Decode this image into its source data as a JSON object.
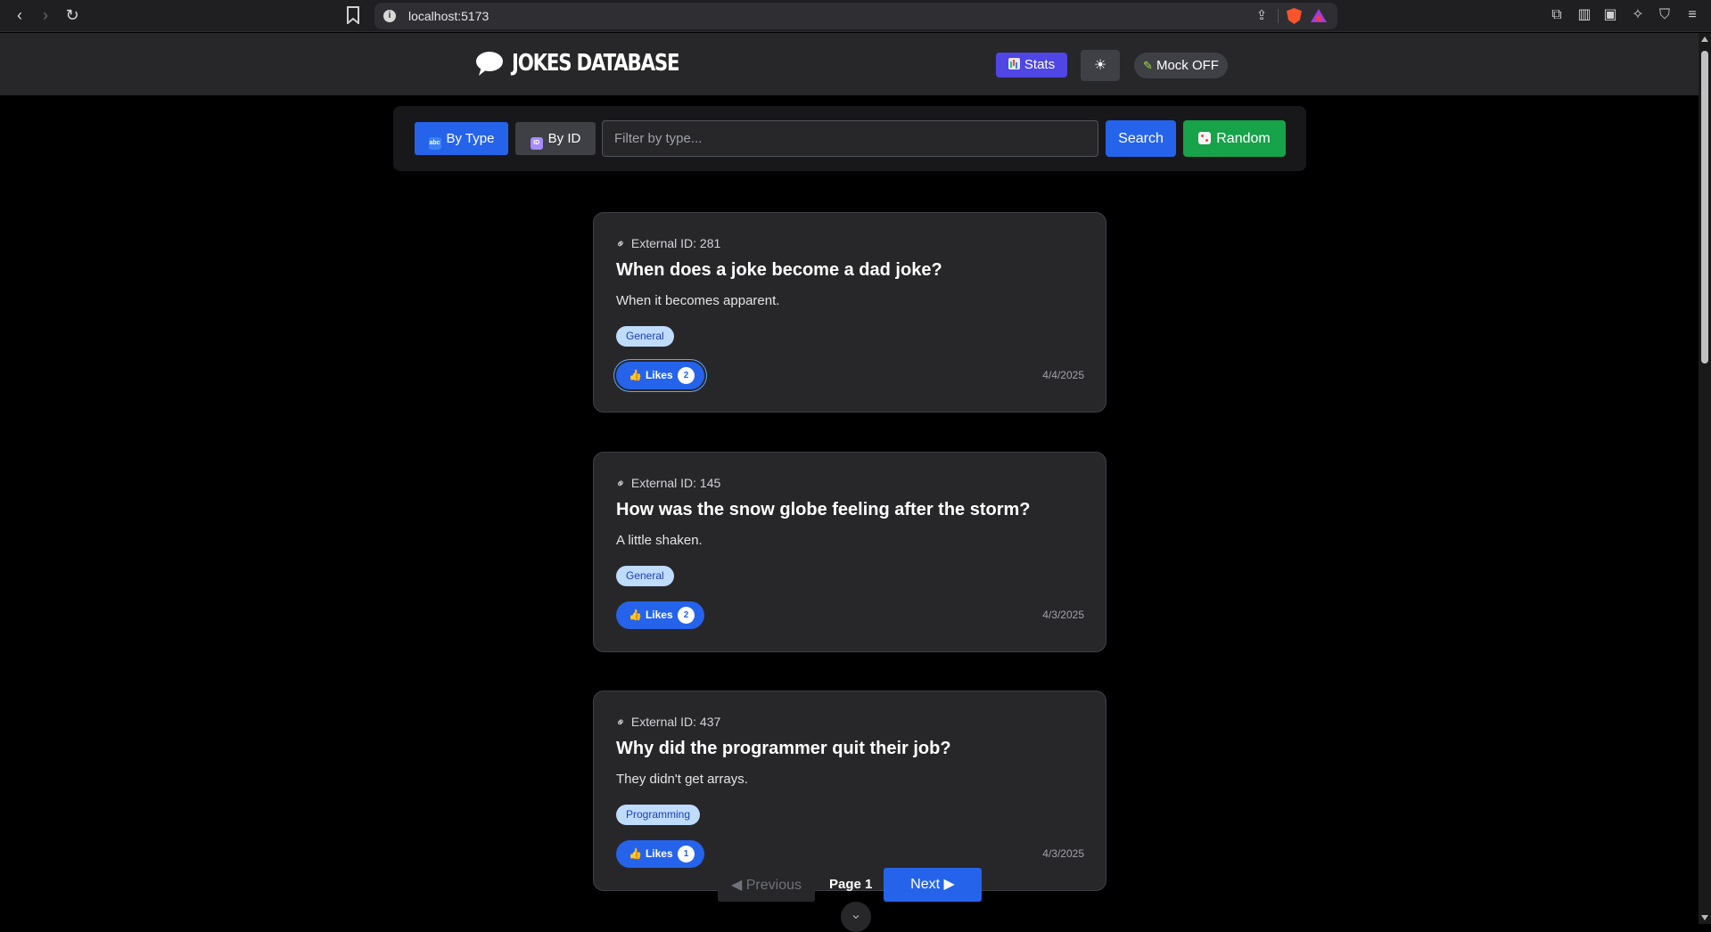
{
  "browser": {
    "url": "localhost:5173"
  },
  "header": {
    "title": "JOKES DATABASE",
    "stats_label": "Stats",
    "theme_icon": "☀",
    "mock_label": "Mock OFF"
  },
  "search": {
    "by_type_label": "By Type",
    "by_id_label": "By ID",
    "placeholder": "Filter by type...",
    "search_label": "Search",
    "random_label": "Random"
  },
  "jokes": [
    {
      "external_id": "External ID: 281",
      "setup": "When does a joke become a dad joke?",
      "punchline": "When it becomes apparent.",
      "type": "General",
      "likes_label": "Likes",
      "likes": "2",
      "date": "4/4/2025"
    },
    {
      "external_id": "External ID: 145",
      "setup": "How was the snow globe feeling after the storm?",
      "punchline": "A little shaken.",
      "type": "General",
      "likes_label": "Likes",
      "likes": "2",
      "date": "4/3/2025"
    },
    {
      "external_id": "External ID: 437",
      "setup": "Why did the programmer quit their job?",
      "punchline": "They didn't get arrays.",
      "type": "Programming",
      "likes_label": "Likes",
      "likes": "1",
      "date": "4/3/2025"
    }
  ],
  "pagination": {
    "previous_label": "◀ Previous",
    "page_label": "Page 1",
    "next_label": "Next ▶"
  },
  "colors": {
    "accent": "#2563eb",
    "success": "#16a34a",
    "stats": "#4f46e5"
  }
}
